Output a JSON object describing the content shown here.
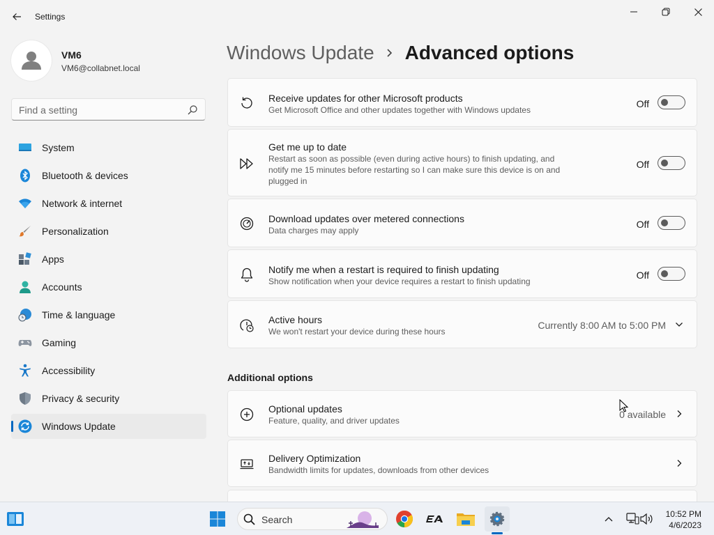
{
  "window": {
    "title": "Settings"
  },
  "profile": {
    "name": "VM6",
    "email": "VM6@collabnet.local"
  },
  "search": {
    "placeholder": "Find a setting"
  },
  "sidebar": {
    "items": [
      {
        "label": "System",
        "icon": "system-icon"
      },
      {
        "label": "Bluetooth & devices",
        "icon": "bluetooth-icon"
      },
      {
        "label": "Network & internet",
        "icon": "wifi-icon"
      },
      {
        "label": "Personalization",
        "icon": "paintbrush-icon"
      },
      {
        "label": "Apps",
        "icon": "apps-icon"
      },
      {
        "label": "Accounts",
        "icon": "accounts-icon"
      },
      {
        "label": "Time & language",
        "icon": "clock-globe-icon"
      },
      {
        "label": "Gaming",
        "icon": "gamepad-icon"
      },
      {
        "label": "Accessibility",
        "icon": "accessibility-icon"
      },
      {
        "label": "Privacy & security",
        "icon": "shield-icon"
      },
      {
        "label": "Windows Update",
        "icon": "windows-update-icon",
        "active": true
      }
    ]
  },
  "breadcrumb": {
    "parent": "Windows Update",
    "current": "Advanced options"
  },
  "settings": [
    {
      "title": "Receive updates for other Microsoft products",
      "desc": "Get Microsoft Office and other updates together with Windows updates",
      "state": "Off",
      "icon": "refresh-icon"
    },
    {
      "title": "Get me up to date",
      "desc": "Restart as soon as possible (even during active hours) to finish updating, and notify me 15 minutes before restarting so I can make sure this device is on and plugged in",
      "state": "Off",
      "icon": "fast-forward-icon"
    },
    {
      "title": "Download updates over metered connections",
      "desc": "Data charges may apply",
      "state": "Off",
      "icon": "gauge-icon"
    },
    {
      "title": "Notify me when a restart is required to finish updating",
      "desc": "Show notification when your device requires a restart to finish updating",
      "state": "Off",
      "icon": "bell-icon"
    },
    {
      "title": "Active hours",
      "desc": "We won't restart your device during these hours",
      "value": "Currently 8:00 AM to 5:00 PM",
      "icon": "active-hours-icon"
    }
  ],
  "additional": {
    "heading": "Additional options",
    "items": [
      {
        "title": "Optional updates",
        "desc": "Feature, quality, and driver updates",
        "value": "0 available",
        "icon": "plus-circle-icon"
      },
      {
        "title": "Delivery Optimization",
        "desc": "Bandwidth limits for updates, downloads from other devices",
        "value": "",
        "icon": "delivery-optimization-icon"
      }
    ]
  },
  "taskbar": {
    "search_label": "Search",
    "time": "10:52 PM",
    "date": "4/6/2023"
  },
  "colors": {
    "accent": "#0067c0",
    "background": "#f3f3f3",
    "card": "#fbfbfb"
  }
}
